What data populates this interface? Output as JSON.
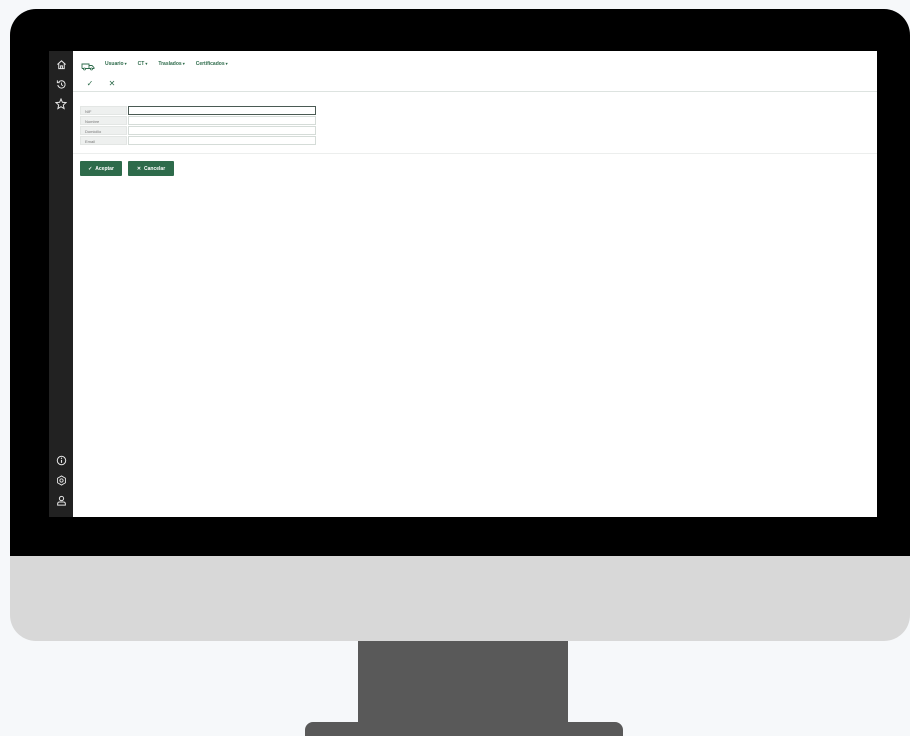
{
  "nav": {
    "items": [
      {
        "label": "Usuario",
        "caret": "▾"
      },
      {
        "label": "CT",
        "caret": "▾"
      },
      {
        "label": "Traslados",
        "caret": "▾"
      },
      {
        "label": "Certificados",
        "caret": "▾"
      }
    ]
  },
  "actions": {
    "confirm_icon": "✓",
    "cancel_icon": "✕"
  },
  "form": {
    "fields": [
      {
        "label": "NIF",
        "value": ""
      },
      {
        "label": "Nombre",
        "value": ""
      },
      {
        "label": "Domicilio",
        "value": ""
      },
      {
        "label": "Email",
        "value": ""
      }
    ]
  },
  "buttons": {
    "accept": {
      "icon": "✓",
      "label": "Aceptar"
    },
    "cancel": {
      "icon": "✕",
      "label": "Cancelar"
    }
  },
  "colors": {
    "accent": "#2e6b4b",
    "sidebar": "#222222",
    "bezel": "#000000",
    "chin": "#d8d8d8",
    "stand": "#595959"
  },
  "icons": {
    "sidebar_top": [
      "home-icon",
      "history-icon",
      "star-icon"
    ],
    "sidebar_bottom": [
      "info-icon",
      "settings-icon",
      "user-icon"
    ],
    "logo": "truck-icon"
  }
}
